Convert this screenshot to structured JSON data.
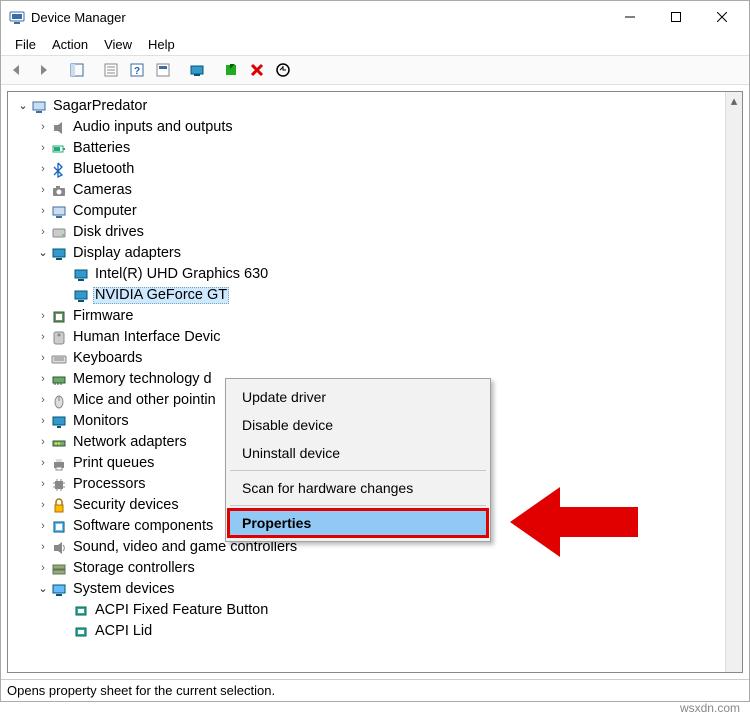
{
  "window": {
    "title": "Device Manager"
  },
  "menubar": {
    "items": [
      "File",
      "Action",
      "View",
      "Help"
    ]
  },
  "tree": {
    "root": "SagarPredator",
    "categories": [
      {
        "label": "Audio inputs and outputs",
        "icon": "speaker-icon",
        "expanded": false
      },
      {
        "label": "Batteries",
        "icon": "battery-icon",
        "expanded": false
      },
      {
        "label": "Bluetooth",
        "icon": "bluetooth-icon",
        "expanded": false
      },
      {
        "label": "Cameras",
        "icon": "camera-icon",
        "expanded": false
      },
      {
        "label": "Computer",
        "icon": "computer-icon",
        "expanded": false
      },
      {
        "label": "Disk drives",
        "icon": "disk-icon",
        "expanded": false
      },
      {
        "label": "Display adapters",
        "icon": "display-icon",
        "expanded": true,
        "children": [
          {
            "label": "Intel(R) UHD Graphics 630",
            "icon": "display-icon"
          },
          {
            "label": "NVIDIA GeForce GT",
            "icon": "display-icon",
            "selected": true,
            "truncated": true
          }
        ]
      },
      {
        "label": "Firmware",
        "icon": "firmware-icon",
        "expanded": false
      },
      {
        "label": "Human Interface Devic",
        "icon": "hid-icon",
        "expanded": false,
        "truncated": true
      },
      {
        "label": "Keyboards",
        "icon": "keyboard-icon",
        "expanded": false
      },
      {
        "label": "Memory technology d",
        "icon": "memory-icon",
        "expanded": false,
        "truncated": true
      },
      {
        "label": "Mice and other pointin",
        "icon": "mouse-icon",
        "expanded": false,
        "truncated": true
      },
      {
        "label": "Monitors",
        "icon": "monitor-icon",
        "expanded": false
      },
      {
        "label": "Network adapters",
        "icon": "network-icon",
        "expanded": false
      },
      {
        "label": "Print queues",
        "icon": "printer-icon",
        "expanded": false
      },
      {
        "label": "Processors",
        "icon": "processor-icon",
        "expanded": false
      },
      {
        "label": "Security devices",
        "icon": "security-icon",
        "expanded": false
      },
      {
        "label": "Software components",
        "icon": "software-icon",
        "expanded": false
      },
      {
        "label": "Sound, video and game controllers",
        "icon": "sound-icon",
        "expanded": false
      },
      {
        "label": "Storage controllers",
        "icon": "storage-icon",
        "expanded": false
      },
      {
        "label": "System devices",
        "icon": "system-icon",
        "expanded": true,
        "children": [
          {
            "label": "ACPI Fixed Feature Button",
            "icon": "system-chip-icon"
          },
          {
            "label": "ACPI Lid",
            "icon": "system-chip-icon"
          }
        ]
      }
    ]
  },
  "context_menu": {
    "items": [
      {
        "label": "Update driver",
        "type": "item"
      },
      {
        "label": "Disable device",
        "type": "item"
      },
      {
        "label": "Uninstall device",
        "type": "item"
      },
      {
        "type": "separator"
      },
      {
        "label": "Scan for hardware changes",
        "type": "item"
      },
      {
        "type": "separator"
      },
      {
        "label": "Properties",
        "type": "item",
        "highlighted": true
      }
    ]
  },
  "statusbar": {
    "text": "Opens property sheet for the current selection."
  },
  "watermark": "wsxdn.com",
  "glyphs": {
    "chev_right": "›",
    "chev_down": "⌄"
  }
}
